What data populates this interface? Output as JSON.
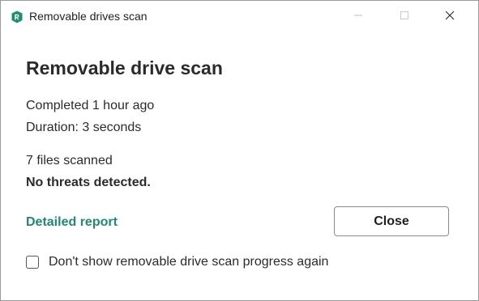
{
  "window": {
    "title": "Removable drives scan",
    "app_icon": "kaspersky-shield-icon",
    "controls": {
      "minimize_icon": "minimize-icon",
      "maximize_icon": "maximize-icon",
      "close_icon": "close-icon"
    }
  },
  "main": {
    "heading": "Removable drive scan",
    "completed": "Completed 1 hour ago",
    "duration": "Duration: 3 seconds",
    "files_scanned": "7 files scanned",
    "threats": "No threats detected."
  },
  "actions": {
    "report_link": "Detailed report",
    "close_label": "Close"
  },
  "option": {
    "checkbox_label": "Don't show removable drive scan progress again",
    "checked": false
  },
  "colors": {
    "accent": "#1f8a70",
    "icon_bg": "#1d8f6f",
    "text": "#2b2b2b"
  }
}
